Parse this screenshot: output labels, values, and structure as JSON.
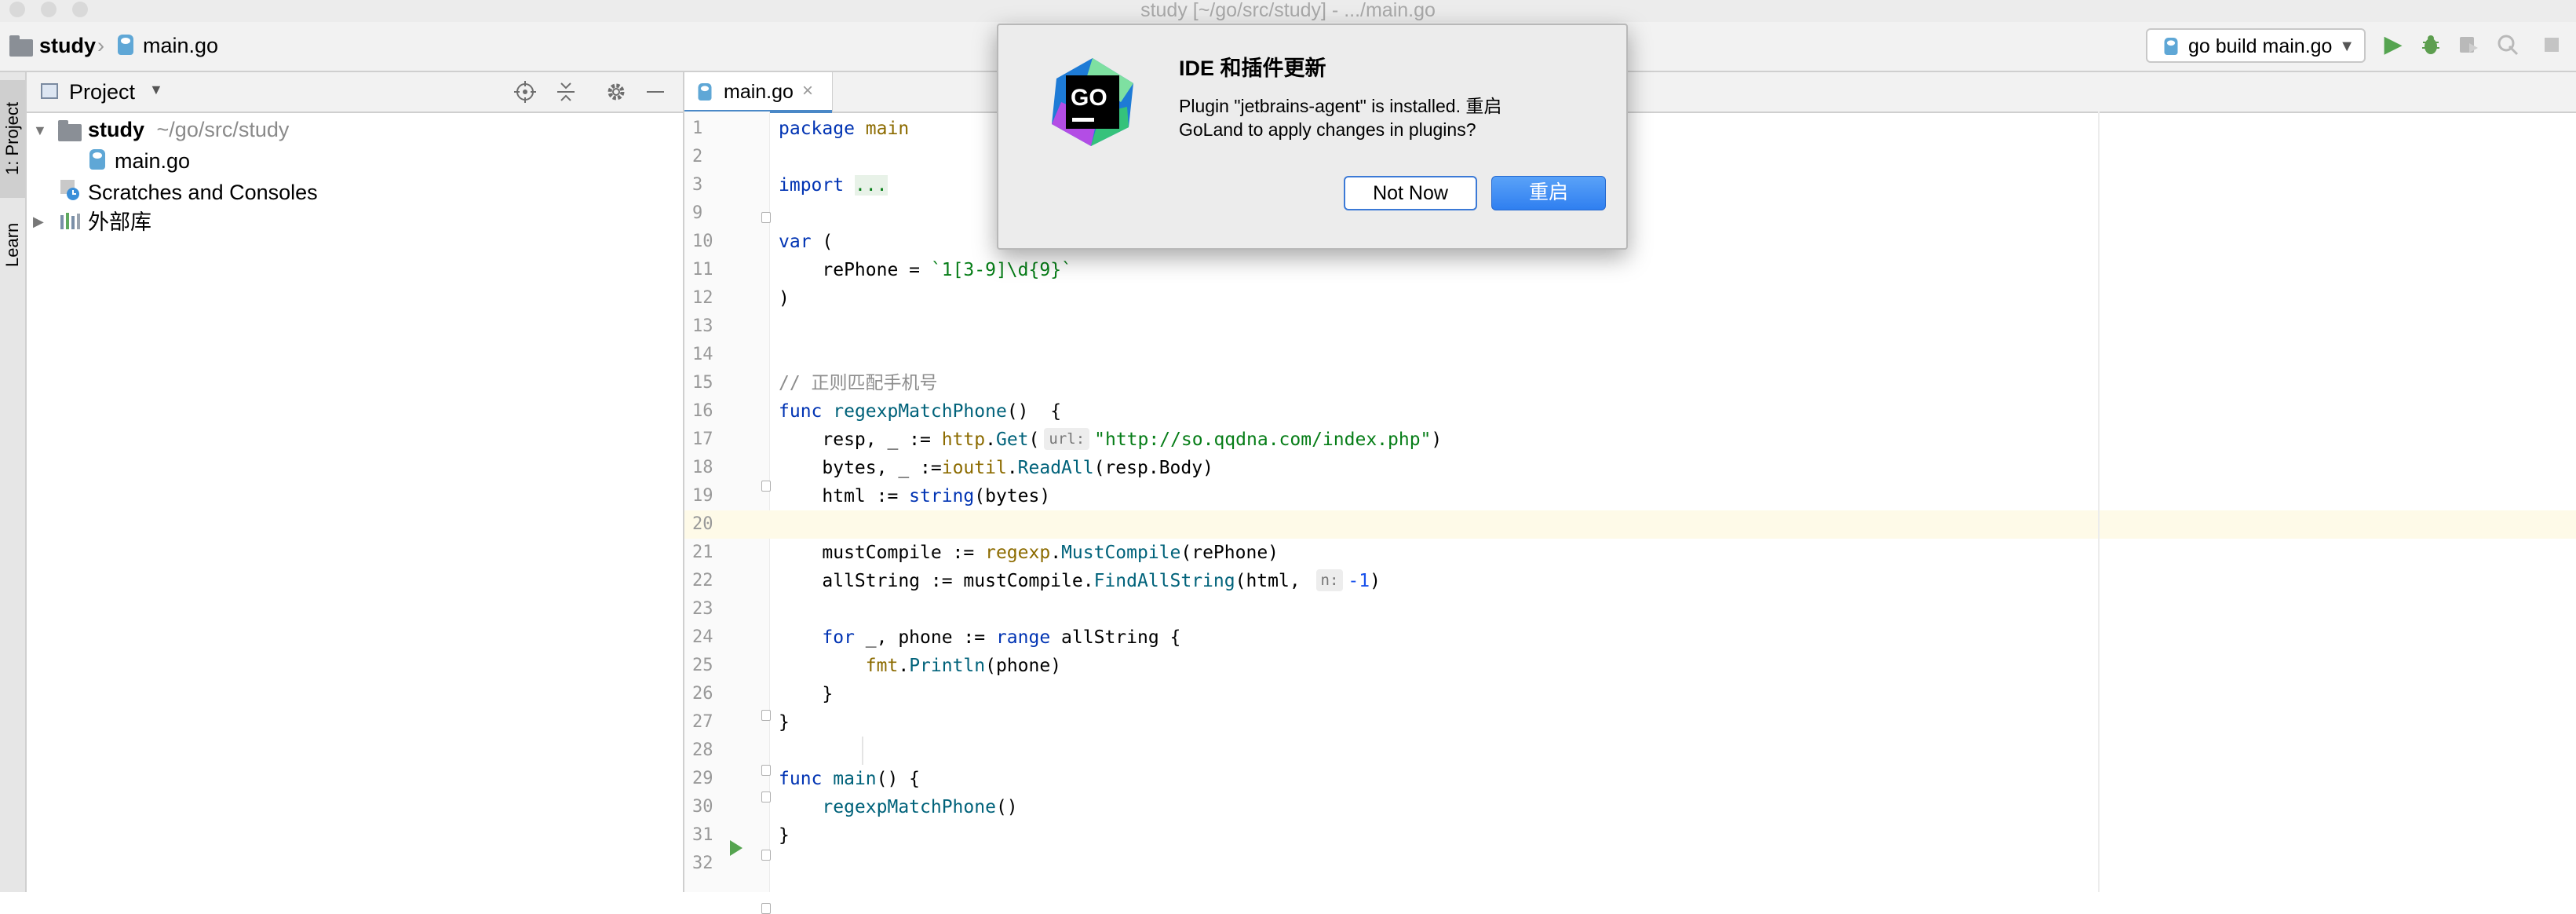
{
  "window": {
    "title": "study [~/go/src/study] - .../main.go"
  },
  "navbar": {
    "breadcrumb_project": "study",
    "breadcrumb_file": "main.go",
    "run_config": "go build main.go"
  },
  "left_strip": {
    "project_tab": "1: Project",
    "learn_tab": "Learn"
  },
  "project_panel": {
    "title": "Project",
    "tree": {
      "root_name": "study",
      "root_path": "~/go/src/study",
      "file": "main.go",
      "scratches": "Scratches and Consoles",
      "external_libs": "外部库"
    }
  },
  "editor": {
    "tab_label": "main.go",
    "lines": [
      {
        "n": "1",
        "html": "<span class=\"kw\">package</span> <span class=\"pkg\">main</span>"
      },
      {
        "n": "2",
        "html": ""
      },
      {
        "n": "3",
        "html": "<span class=\"kw\">import</span> <span class=\"str\" style=\"background:#e8f2e8\">...</span>"
      },
      {
        "n": "9",
        "html": ""
      },
      {
        "n": "10",
        "html": "<span class=\"kw\">var</span> ("
      },
      {
        "n": "11",
        "html": "    rePhone = <span class=\"str\">`1[3-9]\\d{9}`</span>"
      },
      {
        "n": "12",
        "html": ")"
      },
      {
        "n": "13",
        "html": ""
      },
      {
        "n": "14",
        "html": ""
      },
      {
        "n": "15",
        "html": "<span class=\"cmt\">// 正则匹配手机号</span>"
      },
      {
        "n": "16",
        "html": "<span class=\"kw\">func</span> <span class=\"fn\">regexpMatchPhone</span>()  {"
      },
      {
        "n": "17",
        "html": "    resp, _ := <span class=\"pkg\">http</span>.<span class=\"fn\">Get</span>(<span class=\"hint\">url:</span><span class=\"str\">\"http://so.qqdna.com/index.php\"</span>)"
      },
      {
        "n": "18",
        "html": "    bytes, _ :=<span class=\"pkg\">ioutil</span>.<span class=\"fn\">ReadAll</span>(resp.Body)"
      },
      {
        "n": "19",
        "html": "    html := <span class=\"kw\">string</span>(bytes)"
      },
      {
        "n": "20",
        "html": ""
      },
      {
        "n": "21",
        "html": "    mustCompile := <span class=\"pkg\">regexp</span>.<span class=\"fn\">MustCompile</span>(rePhone)"
      },
      {
        "n": "22",
        "html": "    allString := mustCompile.<span class=\"fn\">FindAllString</span>(html, <span class=\"hint\">n:</span><span class=\"num\">-1</span>)"
      },
      {
        "n": "23",
        "html": ""
      },
      {
        "n": "24",
        "html": "    <span class=\"kw\">for</span> _, phone := <span class=\"kw\">range</span> allString {"
      },
      {
        "n": "25",
        "html": "        <span class=\"pkg\">fmt</span>.<span class=\"fn\">Println</span>(phone)"
      },
      {
        "n": "26",
        "html": "    }"
      },
      {
        "n": "27",
        "html": "}"
      },
      {
        "n": "28",
        "html": ""
      },
      {
        "n": "29",
        "html": "<span class=\"kw\">func</span> <span class=\"fn\">main</span>() {"
      },
      {
        "n": "30",
        "html": "    <span class=\"fn\">regexpMatchPhone</span>()"
      },
      {
        "n": "31",
        "html": "}"
      },
      {
        "n": "32",
        "html": ""
      }
    ]
  },
  "dialog": {
    "logo_text": "GO",
    "title": "IDE 和插件更新",
    "message": "Plugin \"jetbrains-agent\" is installed. 重启\nGoLand to apply changes in plugins?",
    "btn_not_now": "Not Now",
    "btn_restart": "重启"
  },
  "colors": {
    "accent": "#2f7ff0",
    "keyword": "#0033b3",
    "string": "#067d17",
    "current_line": "#fefae8",
    "run_green": "#55a450"
  },
  "icons": {
    "toolbar": [
      "run-icon",
      "debug-icon",
      "coverage-icon",
      "profile-icon",
      "stop-icon"
    ],
    "project_header": [
      "locate-icon",
      "collapse-all-icon",
      "gear-icon",
      "hide-icon"
    ]
  }
}
